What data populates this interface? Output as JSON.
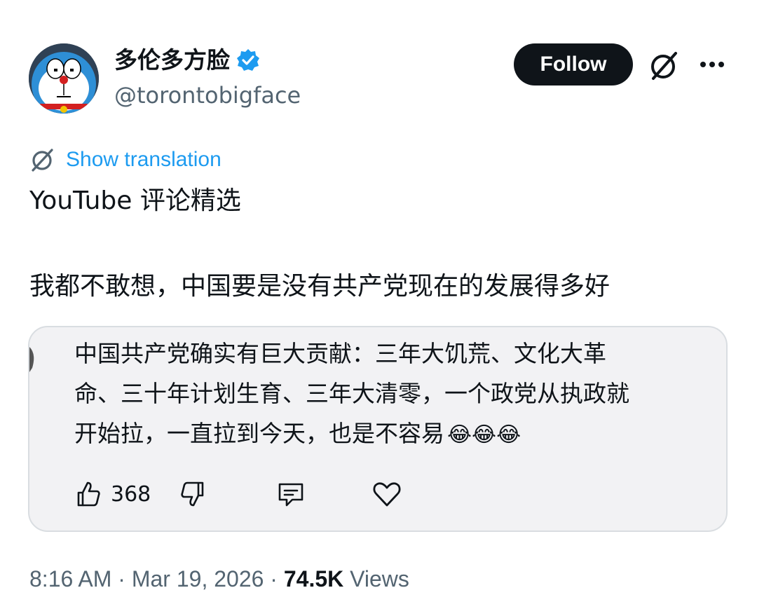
{
  "author": {
    "display_name": "多伦多方脸",
    "handle": "@torontobigface",
    "verified": true
  },
  "actions": {
    "follow_label": "Follow"
  },
  "translation": {
    "label": "Show translation"
  },
  "post": {
    "lines": [
      "YouTube 评论精选",
      "我都不敢想，中国要是没有共产党现在的发展得多好"
    ]
  },
  "quoted_comment": {
    "lines": [
      "中国共产党确实有巨大贡献：三年大饥荒、文化大革",
      "命、三十年计划生育、三年大清零，一个政党从执政就",
      "开始拉，一直拉到今天，也是不容易"
    ],
    "emojis": "😂😂😂",
    "like_count": "368"
  },
  "meta": {
    "time": "8:16 AM",
    "separator": " · ",
    "date": "Mar 19, 2026",
    "views_count": "74.5K",
    "views_label": " Views"
  },
  "colors": {
    "link": "#1d9bf0",
    "verified": "#1d9bf0",
    "text": "#0f1419",
    "secondary": "#536471",
    "follow_bg": "#0f1419"
  },
  "icons": [
    "avatar-doraemon",
    "verified-badge-icon",
    "grok-icon",
    "more-icon",
    "translate-icon",
    "thumbs-up-icon",
    "thumbs-down-icon",
    "reply-icon",
    "heart-icon"
  ]
}
